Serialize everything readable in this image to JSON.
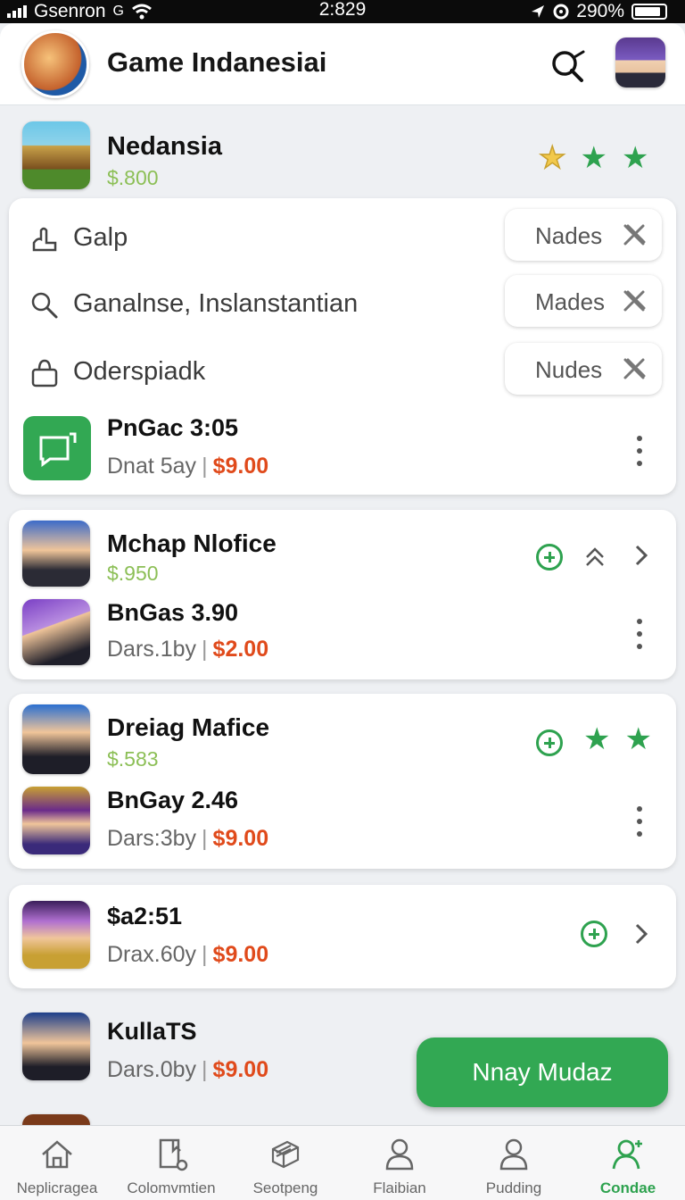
{
  "status_bar": {
    "carrier": "Gsenron",
    "carrier_suffix": "G",
    "time": "2:829",
    "battery": "290%"
  },
  "header": {
    "title": "Game Indanesiai"
  },
  "featured": {
    "name": "Nedansia",
    "price": "$.800",
    "rating_stars": 3
  },
  "filters": [
    {
      "label": "Galp",
      "chip": "Nades",
      "icon": "bell-icon"
    },
    {
      "label": "Ganalnse, Inslanstantian",
      "chip": "Mades",
      "icon": "search-icon"
    },
    {
      "label": "Oderspiadk",
      "chip": "Nudes",
      "icon": "bag-icon"
    }
  ],
  "card1_item": {
    "name": "PnGac 3:05",
    "meta": "Dnat 5ay",
    "amount": "$9.00"
  },
  "card2": {
    "title": "Mchap Nlofice",
    "price": "$.950",
    "item_name": "BnGas 3.90",
    "item_meta": "Dars.1by",
    "item_amount": "$2.00"
  },
  "card3": {
    "title": "Dreiag Mafice",
    "price": "$.583",
    "item_name": "BnGay 2.46",
    "item_meta": "Dars:3by",
    "item_amount": "$9.00"
  },
  "card4": {
    "item_name": "$a2:51",
    "item_meta": "Drax.60y",
    "item_amount": "$9.00"
  },
  "list_item5": {
    "name": "KullaTS",
    "meta": "Dars.0by",
    "amount": "$9.00"
  },
  "fab": {
    "label": "Nnay Mudaz"
  },
  "bottom_nav": [
    {
      "label": "Neplicragea",
      "icon": "home-icon",
      "active": false
    },
    {
      "label": "Colomvmtien",
      "icon": "bookmark-icon",
      "active": false
    },
    {
      "label": "Seotpeng",
      "icon": "box-icon",
      "active": false
    },
    {
      "label": "Flaibian",
      "icon": "person-icon",
      "active": false
    },
    {
      "label": "Pudding",
      "icon": "user-icon",
      "active": false
    },
    {
      "label": "Condae",
      "icon": "user-add-icon",
      "active": true
    }
  ],
  "colors": {
    "accent_green": "#32a853",
    "price_red": "#e04a1b",
    "price_green": "#8cbf56",
    "star_gold": "#f2c94c"
  }
}
